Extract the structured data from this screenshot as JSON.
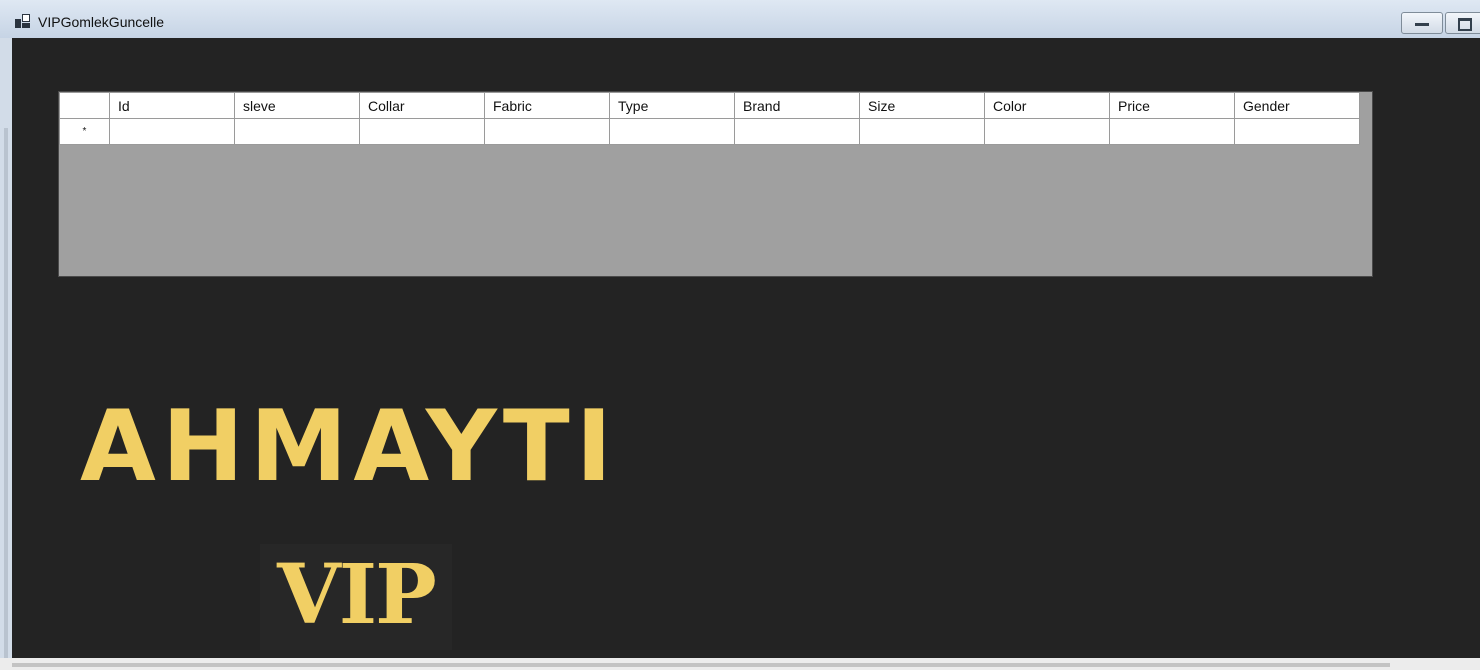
{
  "window": {
    "title": "VIPGomlekGuncelle"
  },
  "grid": {
    "columns": [
      "Id",
      "sleve",
      "Collar",
      "Fabric",
      "Type",
      "Brand",
      "Size",
      "Color",
      "Price",
      "Gender"
    ],
    "new_row_marker": "*"
  },
  "brand": {
    "name": "AHMAYTI",
    "tag": "VIP",
    "color": "#f1cf64"
  },
  "icons": {
    "app": "app-window-icon",
    "minimize": "minimize-icon",
    "maximize": "maximize-icon"
  }
}
